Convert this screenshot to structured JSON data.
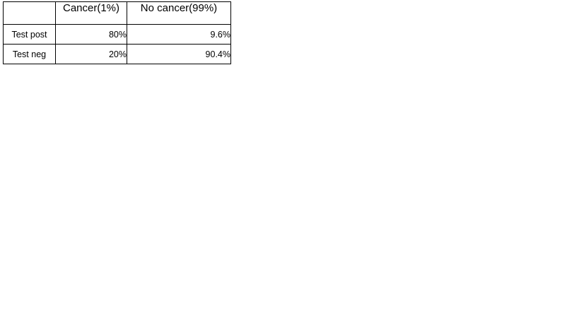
{
  "table": {
    "columns": [
      "",
      "Cancer(1%)",
      "No cancer(99%)"
    ],
    "rows": [
      {
        "label": "Test post",
        "values": [
          "80%",
          "9.6%"
        ]
      },
      {
        "label": "Test neg",
        "values": [
          "20%",
          "90.4%"
        ]
      }
    ]
  }
}
